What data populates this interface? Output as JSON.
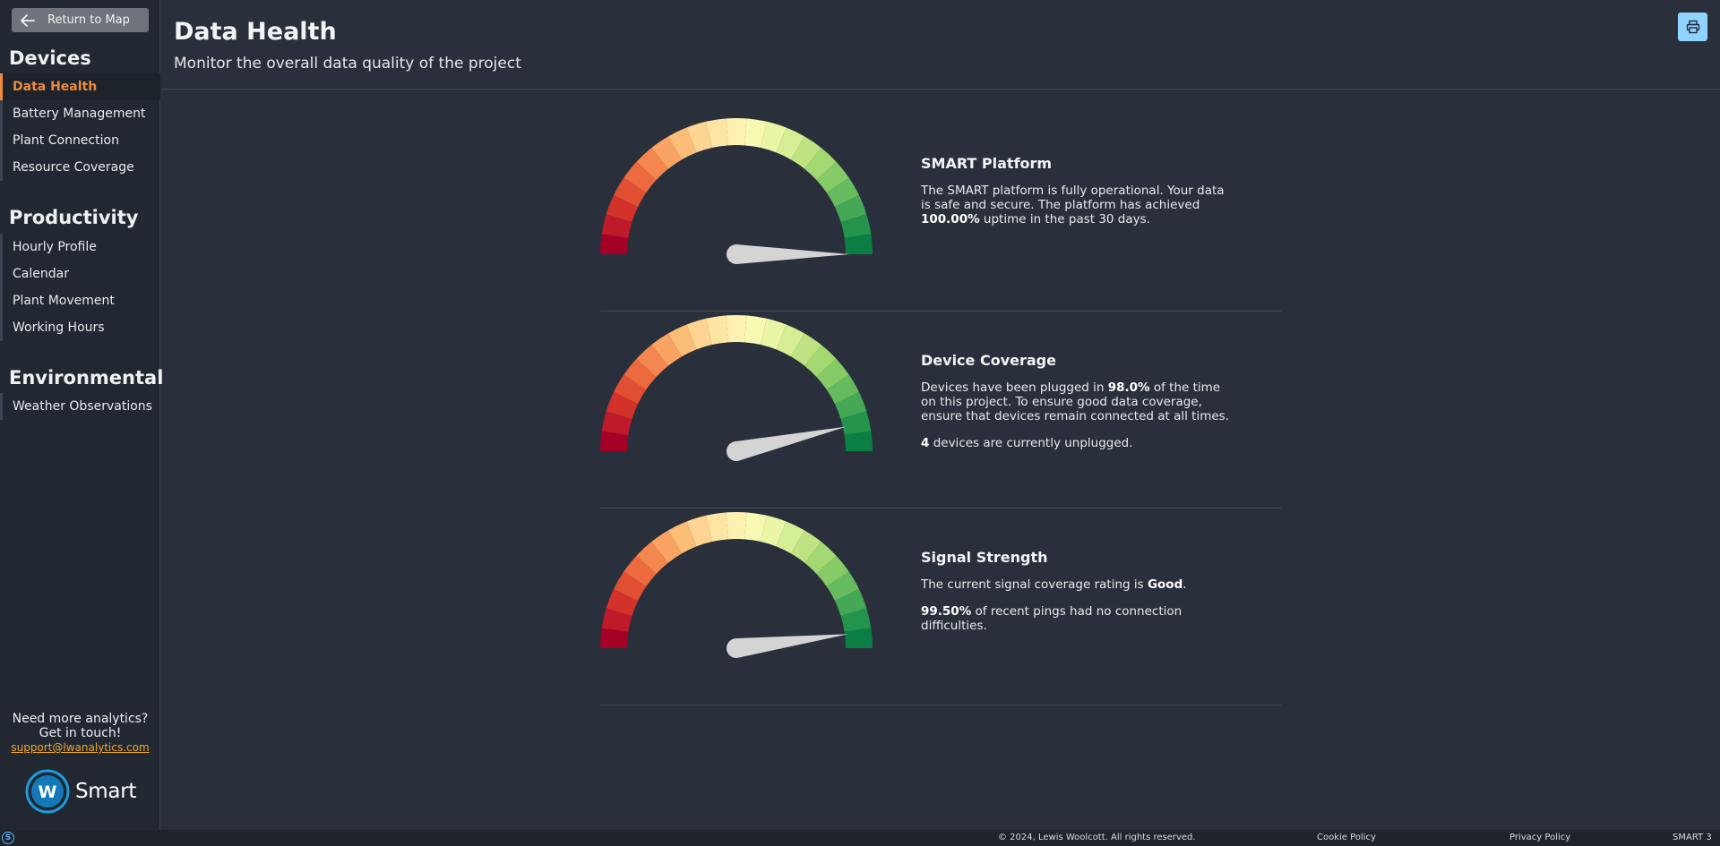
{
  "sidebar": {
    "return_label": "Return to Map",
    "sections": [
      {
        "title": "Devices",
        "items": [
          "Data Health",
          "Battery Management",
          "Plant Connection",
          "Resource Coverage"
        ]
      },
      {
        "title": "Productivity",
        "items": [
          "Hourly Profile",
          "Calendar",
          "Plant Movement",
          "Working Hours"
        ]
      },
      {
        "title": "Environmental",
        "items": [
          "Weather Observations"
        ]
      }
    ],
    "active_item": "Data Health",
    "promo_line1": "Need more analytics?",
    "promo_line2": "Get in touch!",
    "promo_email": "support@lwanalytics.com",
    "brand_text": "Smart",
    "brand_logo_letters": "W"
  },
  "header": {
    "title": "Data Health",
    "subtitle": "Monitor the overall data quality of the project",
    "print_icon": "printer-icon"
  },
  "gauges": [
    {
      "title": "SMART Platform",
      "needle_fraction": 1.0,
      "p1_a": "The SMART platform is fully operational. Your data is safe and secure. The platform has achieved ",
      "p1_b": "100.00%",
      "p1_c": " uptime in the past 30 days."
    },
    {
      "title": "Device Coverage",
      "needle_fraction": 0.93,
      "p1_a": "Devices have been plugged in ",
      "p1_b": "98.0%",
      "p1_c": " of the time on this project. To ensure good data coverage, ensure that devices remain connected at all times.",
      "p2_a": "4",
      "p2_b": " devices are currently unplugged."
    },
    {
      "title": "Signal Strength",
      "needle_fraction": 0.96,
      "p1_a": "The current signal coverage rating is ",
      "p1_b": "Good",
      "p1_c": ".",
      "p2_a": "99.50%",
      "p2_b": " of recent pings had no connection difficulties."
    }
  ],
  "footer": {
    "copyright": "© 2024, Lewis Woolcott. All rights reserved.",
    "cookie": "Cookie Policy",
    "privacy": "Privacy Policy",
    "version": "SMART 3",
    "badge": "S"
  },
  "colors": {
    "accent": "#f08a3c",
    "link": "#f0a52a",
    "print_button": "#8fd3ff",
    "needle": "#d4d4d4"
  }
}
